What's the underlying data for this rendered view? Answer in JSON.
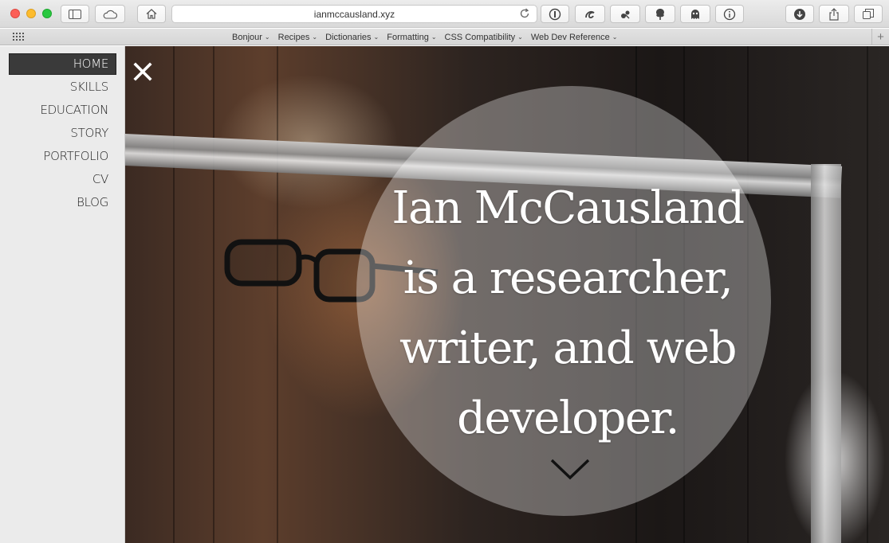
{
  "browser": {
    "url": "ianmccausland.xyz",
    "favorites": [
      {
        "label": "Bonjour"
      },
      {
        "label": "Recipes"
      },
      {
        "label": "Dictionaries"
      },
      {
        "label": "Formatting"
      },
      {
        "label": "CSS Compatibility"
      },
      {
        "label": "Web Dev Reference"
      }
    ]
  },
  "nav": {
    "items": [
      "HOME",
      "SKILLS",
      "EDUCATION",
      "STORY",
      "PORTFOLIO",
      "CV",
      "BLOG"
    ],
    "active": "HOME"
  },
  "hero": {
    "headline_lines": [
      "Ian McCausland",
      "is a researcher,",
      "writer, and web",
      "developer."
    ]
  },
  "icons": {
    "close": "close-icon",
    "scroll": "chevron-down-icon"
  }
}
